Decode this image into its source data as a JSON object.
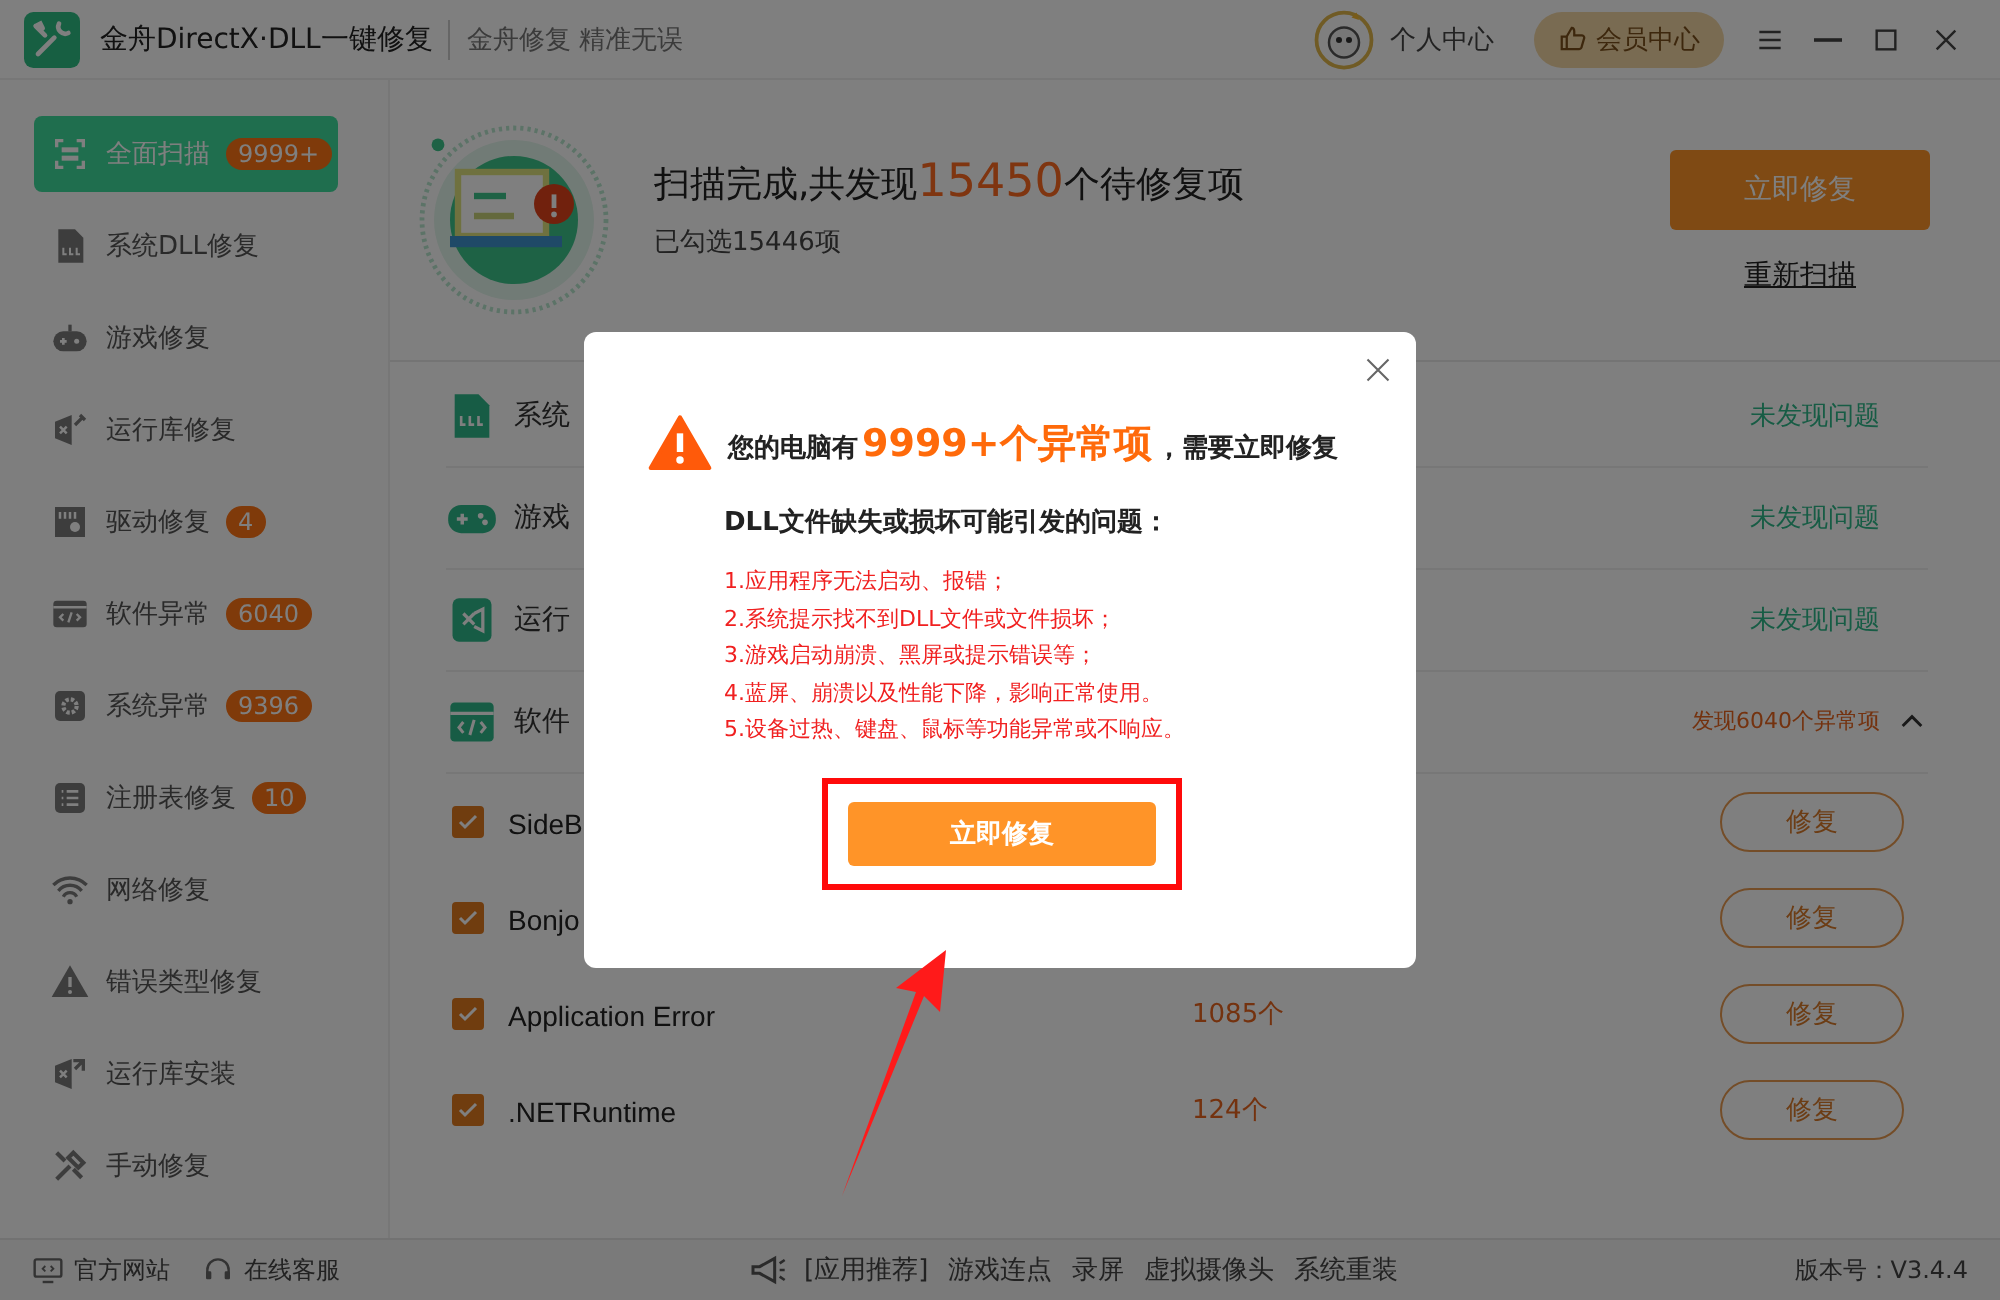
{
  "window": {
    "title": "金舟DirectX·DLL一键修复",
    "slogan": "金舟修复 精准无误",
    "user_label": "个人中心",
    "vip_label": "会员中心"
  },
  "sidebar": {
    "items": [
      {
        "label": "全面扫描",
        "badge": "9999+",
        "selected": true
      },
      {
        "label": "系统DLL修复",
        "selected": false
      },
      {
        "label": "游戏修复",
        "selected": false
      },
      {
        "label": "运行库修复",
        "selected": false
      },
      {
        "label": "驱动修复",
        "badge": "4",
        "selected": false
      },
      {
        "label": "软件异常",
        "badge": "6040",
        "selected": false
      },
      {
        "label": "系统异常",
        "badge": "9396",
        "selected": false
      },
      {
        "label": "注册表修复",
        "badge": "10",
        "selected": false
      },
      {
        "label": "网络修复",
        "selected": false
      },
      {
        "label": "错误类型修复",
        "selected": false
      },
      {
        "label": "运行库安装",
        "selected": false
      },
      {
        "label": "手动修复",
        "selected": false
      }
    ]
  },
  "scan": {
    "prefix": "扫描完成,共发现",
    "count": "15450",
    "suffix": "个待修复项",
    "selected_info": "已勾选15446项",
    "fix_button": "立即修复",
    "rescan_link": "重新扫描"
  },
  "categories": [
    {
      "name": "系统",
      "status": "未发现问题",
      "kind": "ok",
      "expanded": false
    },
    {
      "name": "游戏",
      "status": "未发现问题",
      "kind": "ok",
      "expanded": false
    },
    {
      "name": "运行",
      "status": "未发现问题",
      "kind": "ok",
      "expanded": false
    },
    {
      "name": "软件",
      "status": "发现6040个异常项",
      "kind": "issue",
      "expanded": true
    }
  ],
  "items": [
    {
      "name": "SideB",
      "checked": true,
      "button": "修复"
    },
    {
      "name": "Bonjo",
      "checked": true,
      "button": "修复"
    },
    {
      "name": "Application Error",
      "count": "1085个",
      "checked": true,
      "button": "修复"
    },
    {
      "name": ".NETRuntime",
      "count": "124个",
      "checked": true,
      "button": "修复"
    }
  ],
  "modal": {
    "prefix": "您的电脑有",
    "highlight": "9999+个异常项",
    "suffix": "，需要立即修复",
    "subtitle": "DLL文件缺失或损坏可能引发的问题：",
    "issues": [
      "1.应用程序无法启动、报错；",
      "2.系统提示找不到DLL文件或文件损坏；",
      "3.游戏启动崩溃、黑屏或提示错误等；",
      "4.蓝屏、崩溃以及性能下降，影响正常使用。",
      "5.设备过热、键盘、鼠标等功能异常或不响应。"
    ],
    "button": "立即修复"
  },
  "footer": {
    "links": [
      "官方网站",
      "在线客服"
    ],
    "promo_label": "[应用推荐]",
    "promos": [
      "游戏连点",
      "录屏",
      "虚拟摄像头",
      "系统重装"
    ],
    "version": "版本号：V3.4.4"
  }
}
